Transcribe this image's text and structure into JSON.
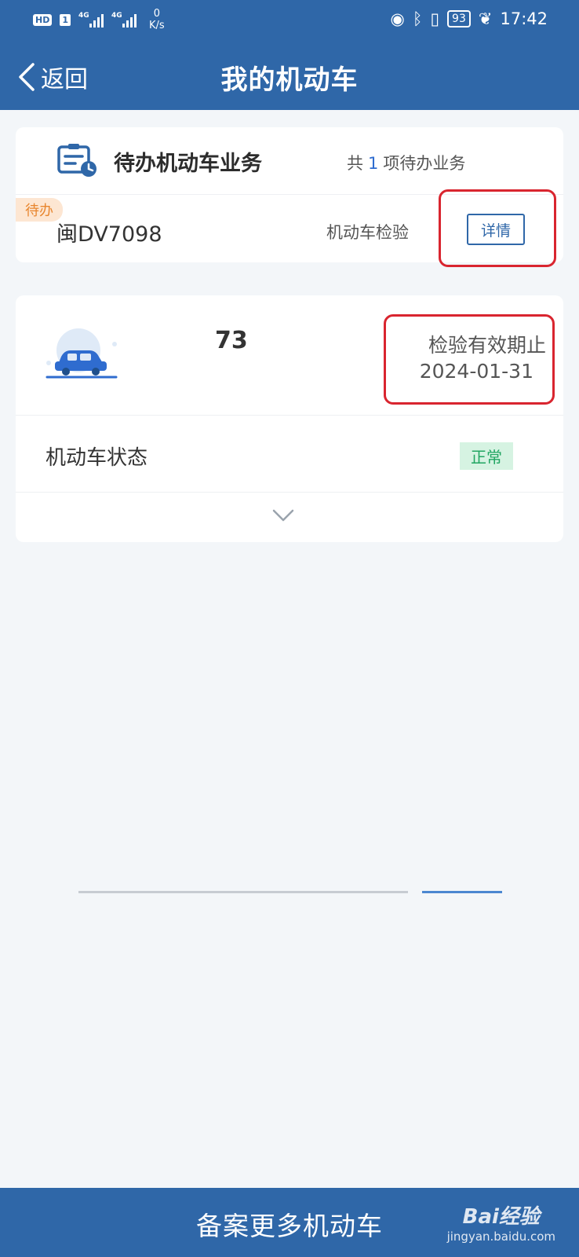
{
  "status_bar": {
    "hd": "HD",
    "sim": "1",
    "net1": "4G",
    "net2": "4G",
    "speed_value": "0",
    "speed_unit": "K/s",
    "battery": "93",
    "time": "17:42",
    "icons": [
      "eye-icon",
      "bluetooth-icon",
      "vibrate-icon",
      "battery-icon",
      "leaf-icon"
    ]
  },
  "header": {
    "back_label": "返回",
    "title": "我的机动车"
  },
  "pending_card": {
    "title": "待办机动车业务",
    "count_prefix": "共",
    "count": "1",
    "count_suffix": "项待办业务",
    "tag": "待办",
    "plate": "闽DV7098",
    "business": "机动车检验",
    "detail_button": "详情"
  },
  "vehicle_card": {
    "plate": "73",
    "valid_label": "检验有效期止",
    "valid_date": "2024-01-31",
    "status_label": "机动车状态",
    "status_value": "正常"
  },
  "bottom": {
    "button": "备案更多机动车",
    "watermark_logo": "Bai经验",
    "watermark_url": "jingyan.baidu.com"
  },
  "colors": {
    "primary": "#2f67a8",
    "accent_blue": "#2f6ccf",
    "pending_orange": "#e8862f",
    "status_green": "#21a662",
    "annotation_red": "#d9252f"
  }
}
